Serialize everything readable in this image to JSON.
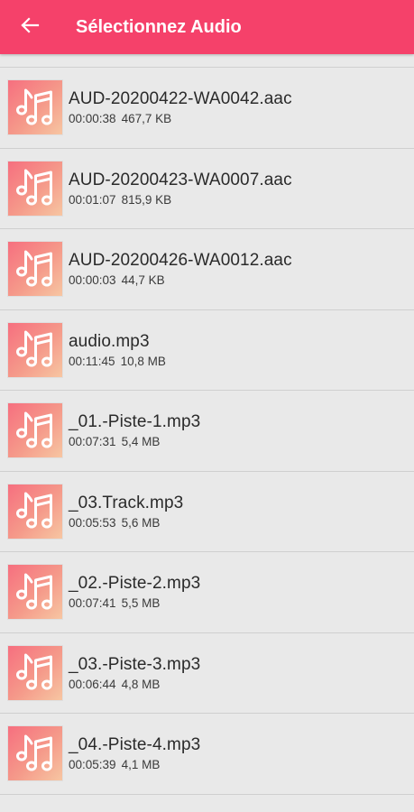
{
  "app": {
    "title": "Sélectionnez Audio",
    "accent": "#f5416a"
  },
  "icons": {
    "back": "arrow-left-icon",
    "item": "music-notes-icon"
  },
  "files": [
    {
      "name": "AUD-20200422-WA0042.aac",
      "duration": "00:00:38",
      "size": "467,7 KB"
    },
    {
      "name": "AUD-20200423-WA0007.aac",
      "duration": "00:01:07",
      "size": "815,9 KB"
    },
    {
      "name": "AUD-20200426-WA0012.aac",
      "duration": "00:00:03",
      "size": "44,7 KB"
    },
    {
      "name": "audio.mp3",
      "duration": "00:11:45",
      "size": "10,8 MB"
    },
    {
      "name": "_01.-Piste-1.mp3",
      "duration": "00:07:31",
      "size": "5,4 MB"
    },
    {
      "name": "_03.Track.mp3",
      "duration": "00:05:53",
      "size": "5,6 MB"
    },
    {
      "name": "_02.-Piste-2.mp3",
      "duration": "00:07:41",
      "size": "5,5 MB"
    },
    {
      "name": "_03.-Piste-3.mp3",
      "duration": "00:06:44",
      "size": "4,8 MB"
    },
    {
      "name": "_04.-Piste-4.mp3",
      "duration": "00:05:39",
      "size": "4,1 MB"
    }
  ]
}
